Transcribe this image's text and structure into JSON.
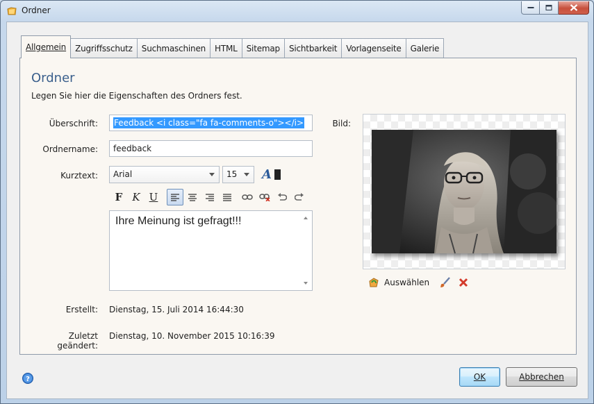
{
  "window": {
    "title": "Ordner",
    "controls": [
      "minimize-icon",
      "maximize-icon",
      "close-icon"
    ]
  },
  "tabs": [
    {
      "label": "Allgemein",
      "active": true
    },
    {
      "label": "Zugriffsschutz",
      "active": false
    },
    {
      "label": "Suchmaschinen",
      "active": false
    },
    {
      "label": "HTML",
      "active": false
    },
    {
      "label": "Sitemap",
      "active": false
    },
    {
      "label": "Sichtbarkeit",
      "active": false
    },
    {
      "label": "Vorlagenseite",
      "active": false
    },
    {
      "label": "Galerie",
      "active": false
    }
  ],
  "panel": {
    "heading": "Ordner",
    "description": "Legen Sie hier die Eigenschaften des Ordners fest."
  },
  "form": {
    "heading_label": "Überschrift:",
    "heading_value": "Feedback <i class=\"fa fa-comments-o\"></i>",
    "foldername_label": "Ordnername:",
    "foldername_value": "feedback",
    "shorttext_label": "Kurztext:",
    "font_value": "Arial",
    "size_value": "15",
    "shorttext_value": "Ihre Meinung ist gefragt!!!",
    "created_label": "Erstellt:",
    "created_value": "Dienstag, 15. Juli 2014 16:44:30",
    "modified_label": "Zuletzt geändert:",
    "modified_value": "Dienstag, 10. November 2015 10:16:39"
  },
  "toolbar": {
    "bold": "F",
    "italic": "K",
    "underline": "U",
    "font_color_glyph": "A",
    "buttons": [
      "bold-icon",
      "italic-icon",
      "underline-icon",
      "align-left-icon",
      "align-center-icon",
      "align-right-icon",
      "align-justify-icon",
      "link-icon",
      "unlink-icon",
      "undo-icon",
      "redo-icon"
    ],
    "active_alignment": "left"
  },
  "image": {
    "label": "Bild:",
    "select_label": "Auswählen"
  },
  "footer": {
    "ok_label": "OK",
    "cancel_label": "Abbrechen"
  },
  "colors": {
    "heading": "#3a5f8c",
    "selection": "#3399ff",
    "panel_bg": "#faf7f2"
  }
}
